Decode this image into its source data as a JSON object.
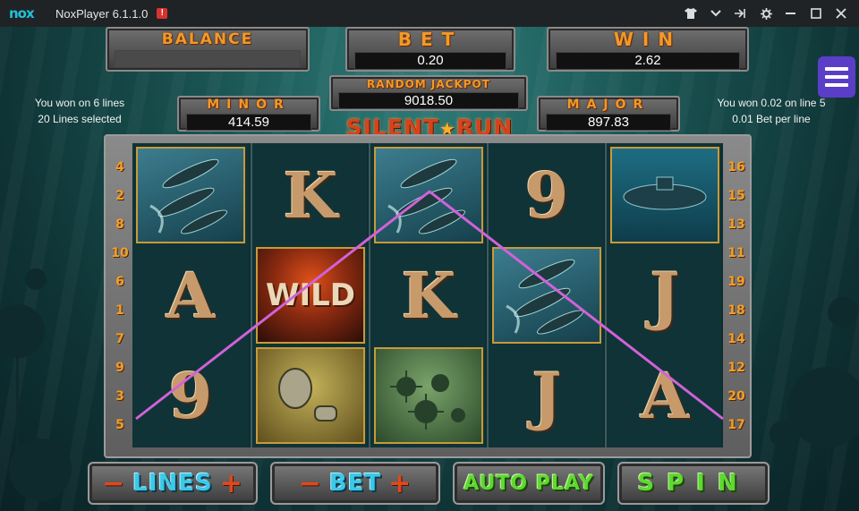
{
  "window": {
    "logo_text": "nox",
    "title": "NoxPlayer 6.1.1.0",
    "badge": "!",
    "controls": [
      "shirt-icon",
      "chevron-down-icon",
      "pin-icon",
      "gear-icon",
      "minimize-icon",
      "maximize-icon",
      "close-icon"
    ]
  },
  "game": {
    "balance_label": "BALANCE",
    "balance_value": "",
    "bet_label": "BET",
    "bet_value": "0.20",
    "win_label": "WIN",
    "win_value": "2.62",
    "jackpot_label": "RANDOM JACKPOT",
    "jackpot_value": "9018.50",
    "minor_label": "MINOR",
    "minor_value": "414.59",
    "major_label": "MAJOR",
    "major_value": "897.83",
    "logo_left": "SILENT",
    "logo_right": "RUN",
    "info_left": [
      "You won on 6 lines",
      "20 Lines selected"
    ],
    "info_right": [
      "You won 0.02 on line 5",
      "0.01 Bet per line"
    ],
    "left_line_numbers": [
      "4",
      "2",
      "8",
      "10",
      "6",
      "1",
      "7",
      "9",
      "3",
      "5"
    ],
    "right_line_numbers": [
      "16",
      "15",
      "13",
      "11",
      "19",
      "18",
      "14",
      "12",
      "20",
      "17"
    ],
    "reels": [
      [
        "torpedo",
        "A",
        "9"
      ],
      [
        "K",
        "WILD",
        "depth-charge"
      ],
      [
        "torpedo",
        "K",
        "mines"
      ],
      [
        "9",
        "torpedo",
        "J"
      ],
      [
        "submarine",
        "J",
        "A"
      ]
    ],
    "buttons": {
      "lines_label": "LINES",
      "bet_label": "BET",
      "autoplay_label": "AUTO PLAY",
      "spin_label": "SPIN",
      "minus": "−",
      "plus": "+"
    }
  },
  "colors": {
    "payline": "#d062d8",
    "accent_orange": "#f09a2a",
    "menu_purple": "#5b3ec7"
  }
}
